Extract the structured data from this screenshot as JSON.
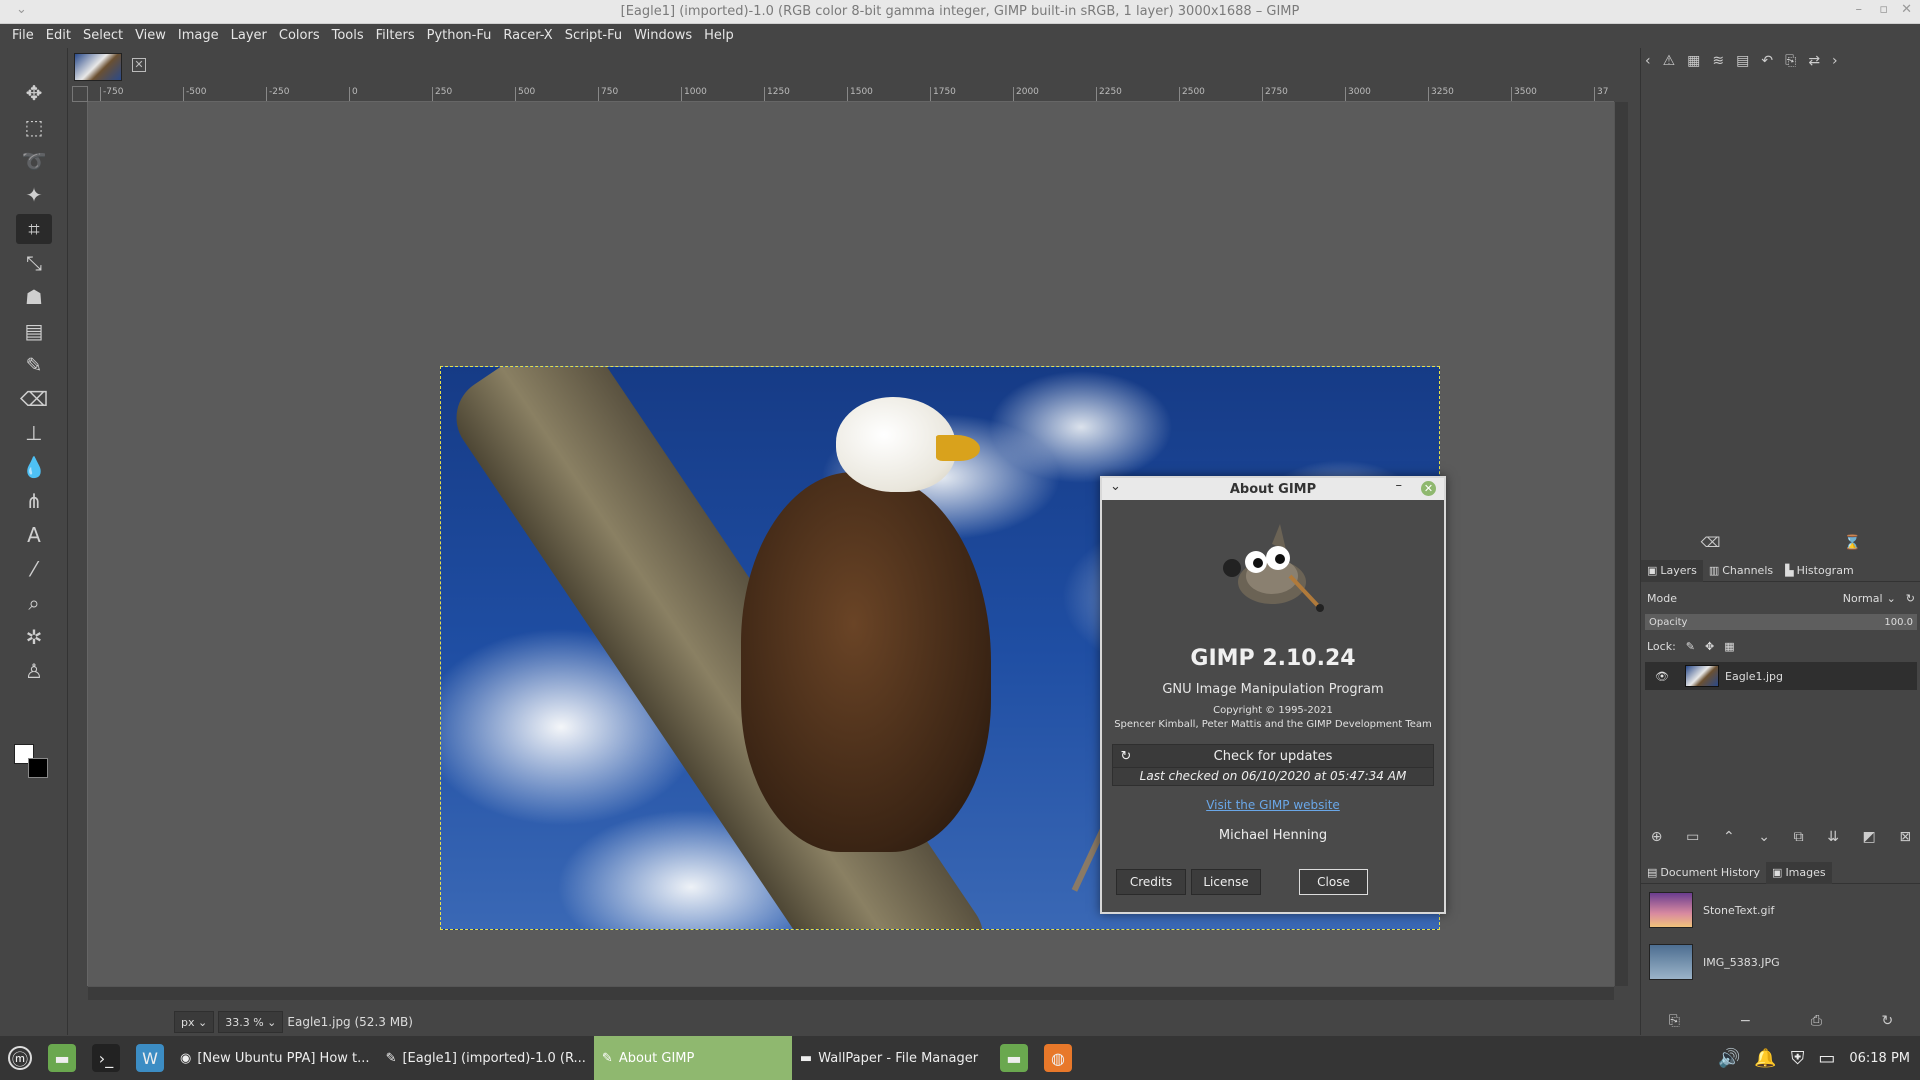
{
  "window": {
    "title": "[Eagle1] (imported)-1.0 (RGB color 8-bit gamma integer, GIMP built-in sRGB, 1 layer) 3000x1688 – GIMP"
  },
  "menu": [
    "File",
    "Edit",
    "Select",
    "View",
    "Image",
    "Layer",
    "Colors",
    "Tools",
    "Filters",
    "Python-Fu",
    "Racer-X",
    "Script-Fu",
    "Windows",
    "Help"
  ],
  "ruler": [
    "-750",
    "-500",
    "-250",
    "0",
    "250",
    "500",
    "750",
    "1000",
    "1250",
    "1500",
    "1750",
    "2000",
    "2250",
    "2500",
    "2750",
    "3000",
    "3250",
    "3500",
    "37"
  ],
  "status": {
    "unit": "px",
    "zoom": "33.3 %",
    "file": "Eagle1.jpg (52.3 MB)"
  },
  "dock": {
    "tabs": [
      "Layers",
      "Channels",
      "Histogram"
    ],
    "mode_label": "Mode",
    "mode_value": "Normal",
    "opacity_label": "Opacity",
    "opacity_value": "100.0",
    "lock_label": "Lock:",
    "layer_name": "Eagle1.jpg",
    "bottom_tabs": [
      "Document History",
      "Images"
    ],
    "images": [
      "StoneText.gif",
      "IMG_5383.JPG"
    ]
  },
  "dialog": {
    "title": "About GIMP",
    "name": "GIMP 2.10.24",
    "subtitle": "GNU Image Manipulation Program",
    "copyright": "Copyright © 1995-2021",
    "authors": "Spencer Kimball, Peter Mattis and the GIMP Development Team",
    "update_button": "Check for updates",
    "last_checked": "Last checked on 06/10/2020 at 05:47:34 AM",
    "website_link": "Visit the GIMP website",
    "person": "Michael Henning",
    "credits": "Credits",
    "license": "License",
    "close": "Close"
  },
  "taskbar": {
    "items": [
      "[New Ubuntu PPA] How t...",
      "[Eagle1] (imported)-1.0 (R...",
      "About GIMP",
      "WallPaper - File Manager"
    ],
    "clock": "06:18 PM"
  },
  "colors": {
    "accent": "#8fb86f",
    "link": "#6aa7e8",
    "selection": "#e6e04a"
  }
}
